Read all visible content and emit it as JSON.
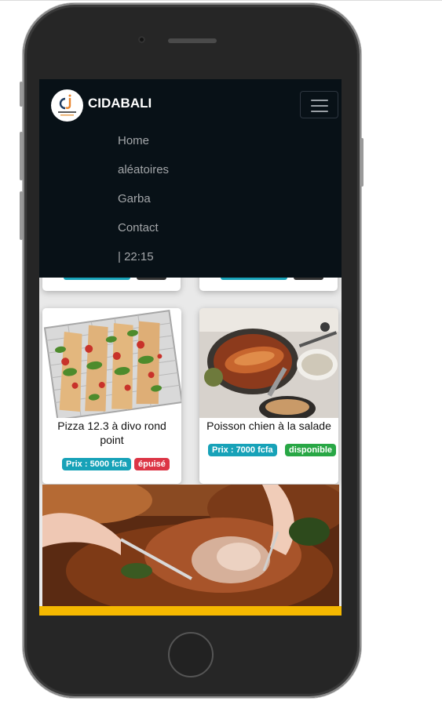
{
  "brand": {
    "name": "CIDABALI",
    "logo_letters": "cj",
    "logo_caption": "PRIVATE COMPANY"
  },
  "nav": {
    "toggle_icon": "hamburger-icon",
    "items": [
      {
        "label": "Home"
      },
      {
        "label": "aléatoires"
      },
      {
        "label": "Garba"
      },
      {
        "label": "Contact"
      },
      {
        "label": "| 22:15"
      }
    ]
  },
  "products": [
    {
      "name": "Pizza 12.3 à divo rond point",
      "price": "Prix : 5000 fcfa",
      "status": "épuisé",
      "status_color": "#dc3545"
    },
    {
      "name": "Poisson chien à la salade",
      "price": "Prix : 7000 fcfa",
      "status": "disponible",
      "status_color": "#28a745"
    }
  ],
  "colors": {
    "navbar_bg": "#081117",
    "price_badge": "#17a2b8",
    "footer_accent": "#f5b800"
  }
}
